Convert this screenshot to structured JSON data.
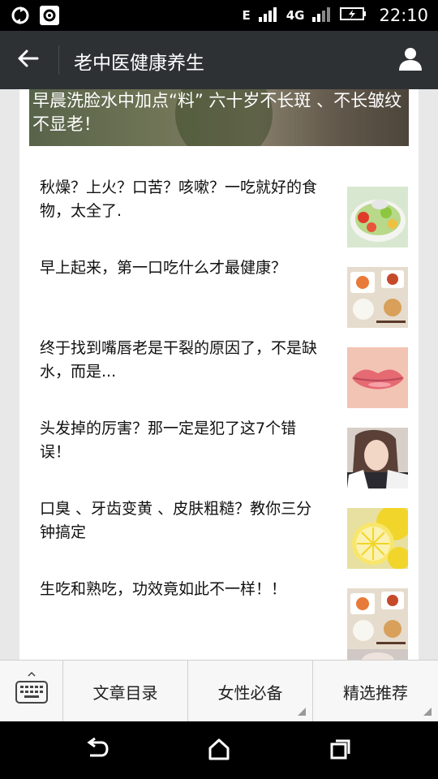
{
  "status_bar": {
    "network": "E",
    "network_4g": "4G",
    "time": "22:10"
  },
  "header": {
    "title": "老中医健康养生"
  },
  "hero": {
    "title": "早晨洗脸水中加点“料” 六十岁不长斑 、不长皱纹不显老！"
  },
  "articles": [
    {
      "title": "秋燥？上火？口苦？咳嗽？一吃就好的食物，太全了.",
      "thumb": "salad-thumbnail"
    },
    {
      "title": "早上起来，第一口吃什么才最健康？",
      "thumb": "breakfast-thumbnail"
    },
    {
      "title": "终于找到嘴唇老是干裂的原因了，不是缺水，而是...",
      "thumb": "lips-thumbnail"
    },
    {
      "title": "头发掉的厉害？那一定是犯了这7个错误！",
      "thumb": "woman-thumbnail"
    },
    {
      "title": "口臭 、牙齿变黄 、皮肤粗糙？教你三分钟搞定",
      "thumb": "lemon-thumbnail"
    },
    {
      "title": "生吃和熟吃，功效竟如此不一样！！",
      "thumb": "breakfast-thumbnail"
    }
  ],
  "bottom_menu": {
    "items": [
      "文章目录",
      "女性必备",
      "精选推荐"
    ]
  },
  "colors": {
    "header_bg": "#2e3134",
    "content_bg": "#e8e8e8"
  }
}
